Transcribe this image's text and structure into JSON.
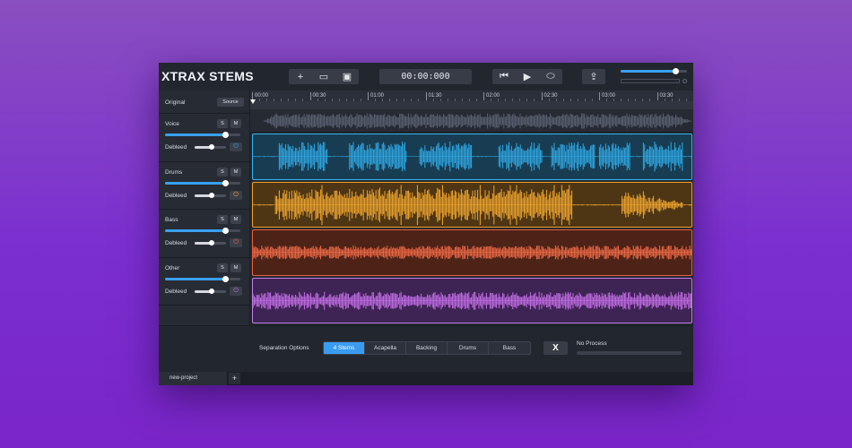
{
  "app": {
    "logo_x": "X",
    "logo_rest": "TRAX STEMS"
  },
  "toolbar": {
    "file_buttons": [
      {
        "icon": "plus-icon",
        "glyph": "+"
      },
      {
        "icon": "folder-icon",
        "glyph": "▭"
      },
      {
        "icon": "save-icon",
        "glyph": "▣"
      }
    ],
    "time": "00:00:000",
    "transport": [
      {
        "icon": "skip-back-icon",
        "glyph": "⏮"
      },
      {
        "icon": "play-icon",
        "glyph": "▶"
      },
      {
        "icon": "loop-icon",
        "glyph": "⬭"
      }
    ],
    "export_glyph": "⇪",
    "volume": 0.82
  },
  "ruler": {
    "ticks": [
      "00:00",
      "00:30",
      "01:00",
      "01:30",
      "02:00",
      "02:30",
      "03:00",
      "03:30"
    ]
  },
  "tracks": {
    "original": {
      "name": "Original",
      "source_label": "Source"
    },
    "stems": [
      {
        "name": "Voice",
        "solo": "S",
        "mute": "M",
        "volume": 0.8,
        "debleed_label": "Debleed",
        "debleed": 0.55,
        "color": "#2fa9e6",
        "fill": "#183d52",
        "border": "#35b4ee"
      },
      {
        "name": "Drums",
        "solo": "S",
        "mute": "M",
        "volume": 0.8,
        "debleed_label": "Debleed",
        "debleed": 0.55,
        "color": "#f2a72e",
        "fill": "#4e3614",
        "border": "#f0a02a"
      },
      {
        "name": "Bass",
        "solo": "S",
        "mute": "M",
        "volume": 0.8,
        "debleed_label": "Debleed",
        "debleed": 0.55,
        "color": "#f06a46",
        "fill": "#4d2317",
        "border": "#e8623c"
      },
      {
        "name": "Other",
        "solo": "S",
        "mute": "M",
        "volume": 0.8,
        "debleed_label": "Debleed",
        "debleed": 0.55,
        "color": "#c56ee8",
        "fill": "#3e2454",
        "border": "#c27ee6"
      }
    ]
  },
  "separation": {
    "label": "Separation Options",
    "options": [
      "4 Stems",
      "Acapella",
      "Backing",
      "Drums",
      "Bass"
    ],
    "selected": "4 Stems",
    "process_glyph": "X",
    "status": "No Process",
    "progress": 0
  },
  "project_tabs": {
    "tabs": [
      "new-project"
    ],
    "add_label": "+"
  }
}
